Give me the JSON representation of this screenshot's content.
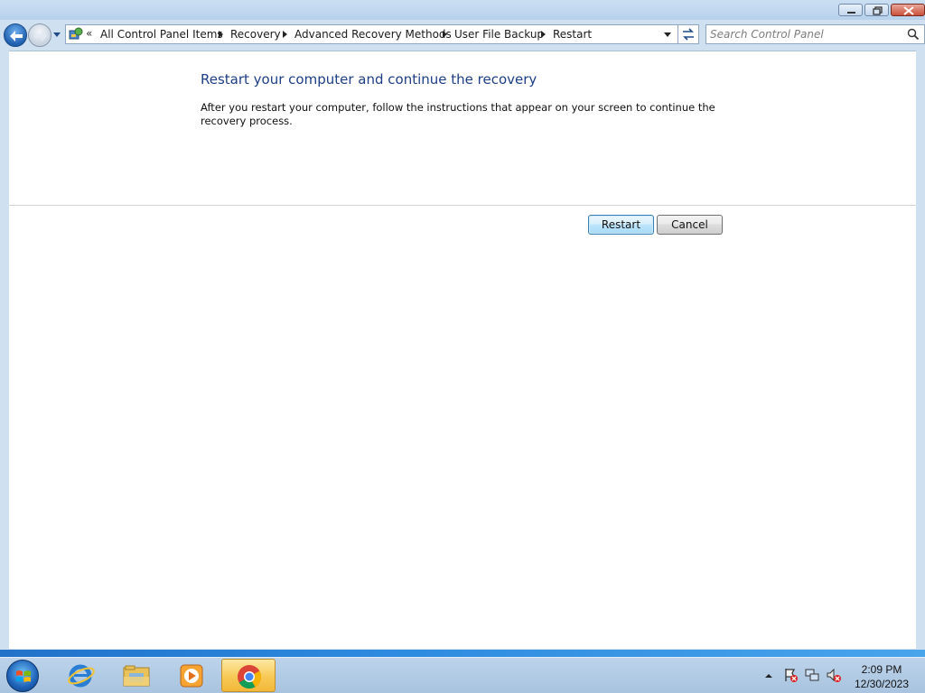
{
  "address_bar": {
    "overflow_glyph": "«",
    "crumbs": [
      "All Control Panel Items",
      "Recovery",
      "Advanced Recovery Methods",
      "User File Backup",
      "Restart"
    ]
  },
  "search": {
    "placeholder": "Search Control Panel"
  },
  "main": {
    "heading": "Restart your computer and continue the recovery",
    "description": "After you restart your computer, follow the instructions that appear on your screen to continue the recovery process.",
    "restart_label": "Restart",
    "cancel_label": "Cancel"
  },
  "taskbar": {
    "apps": [
      "internet-explorer",
      "windows-explorer",
      "windows-media-player",
      "google-chrome"
    ],
    "clock_time": "2:09 PM",
    "clock_date": "12/30/2023"
  },
  "colors": {
    "heading": "#1e3e86",
    "accent": "#3c7fb1"
  }
}
